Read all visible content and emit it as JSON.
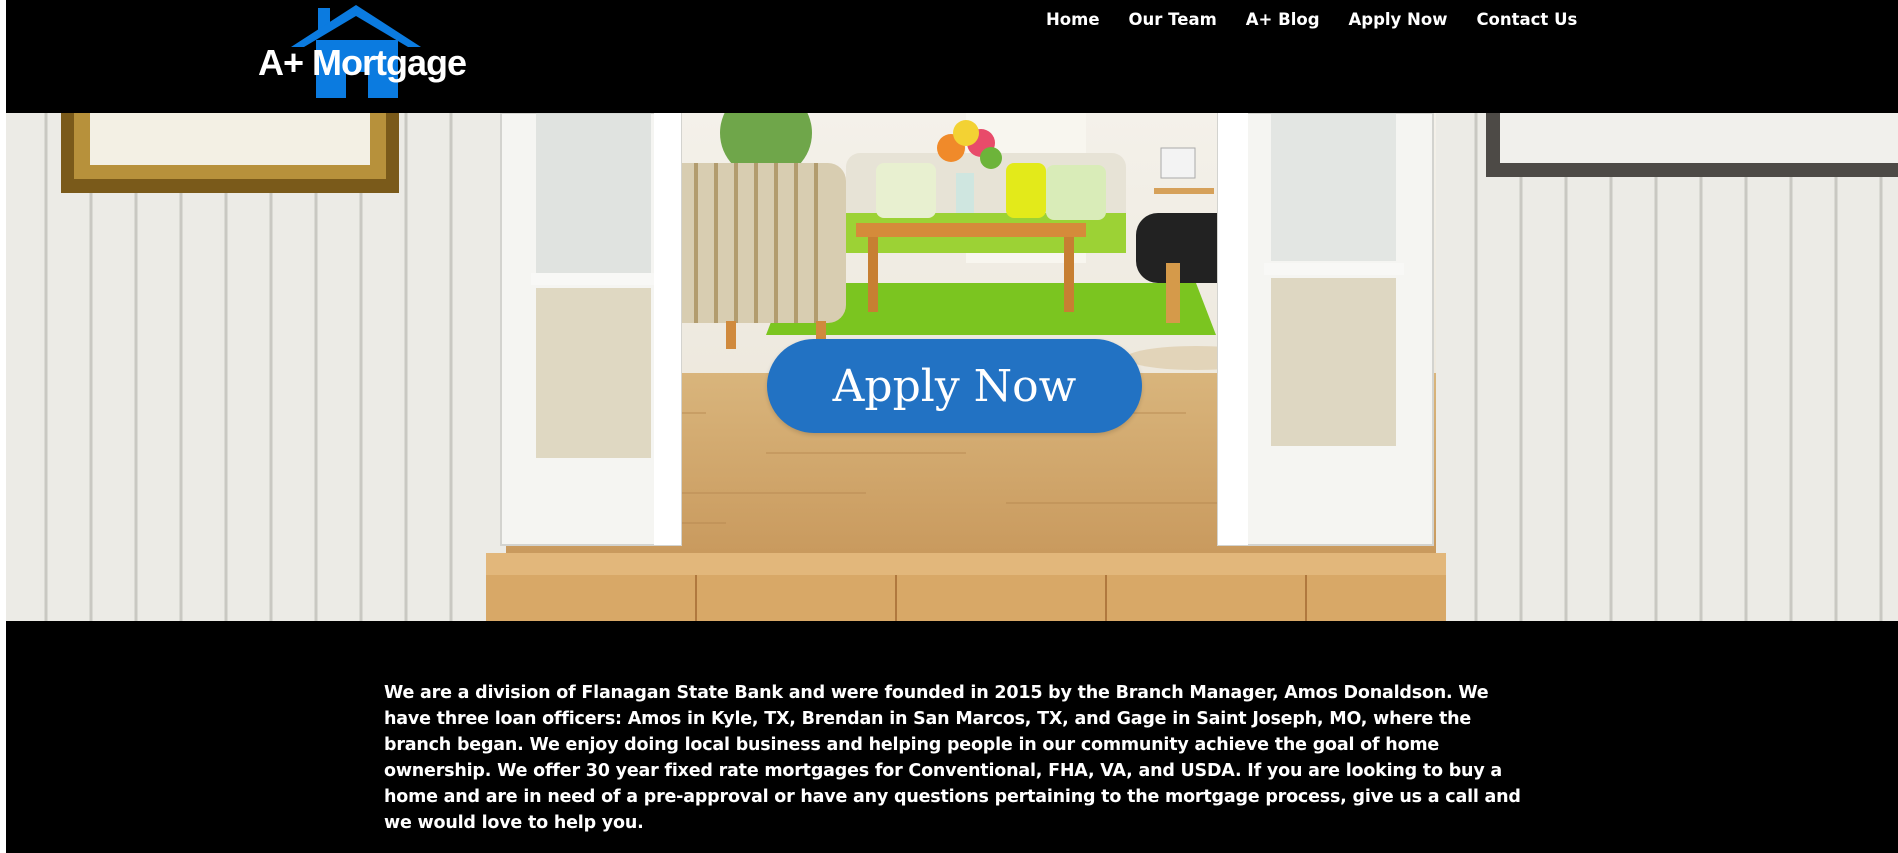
{
  "brand": {
    "logo_text": "A+ Mortgage",
    "logo_color": "#0b7be0"
  },
  "nav": {
    "items": [
      "Home",
      "Our Team",
      "A+ Blog",
      "Apply Now",
      "Contact Us"
    ]
  },
  "hero": {
    "cta_label": "Apply Now",
    "cta_color": "#2272c3"
  },
  "about": {
    "paragraph": "We are a division of Flanagan State Bank and were founded in 2015 by the Branch Manager, Amos Donaldson.  We have three loan officers: Amos in Kyle, TX, Brendan in San Marcos, TX, and Gage in Saint Joseph, MO, where the branch began. We enjoy doing local business and helping people in our community achieve the goal of home ownership. We offer 30 year fixed rate mortgages for Conventional, FHA, VA, and USDA. If you are looking to buy a home and are in need of a pre-approval or have any questions pertaining to the mortgage process, give us a call and we would love to help you."
  }
}
